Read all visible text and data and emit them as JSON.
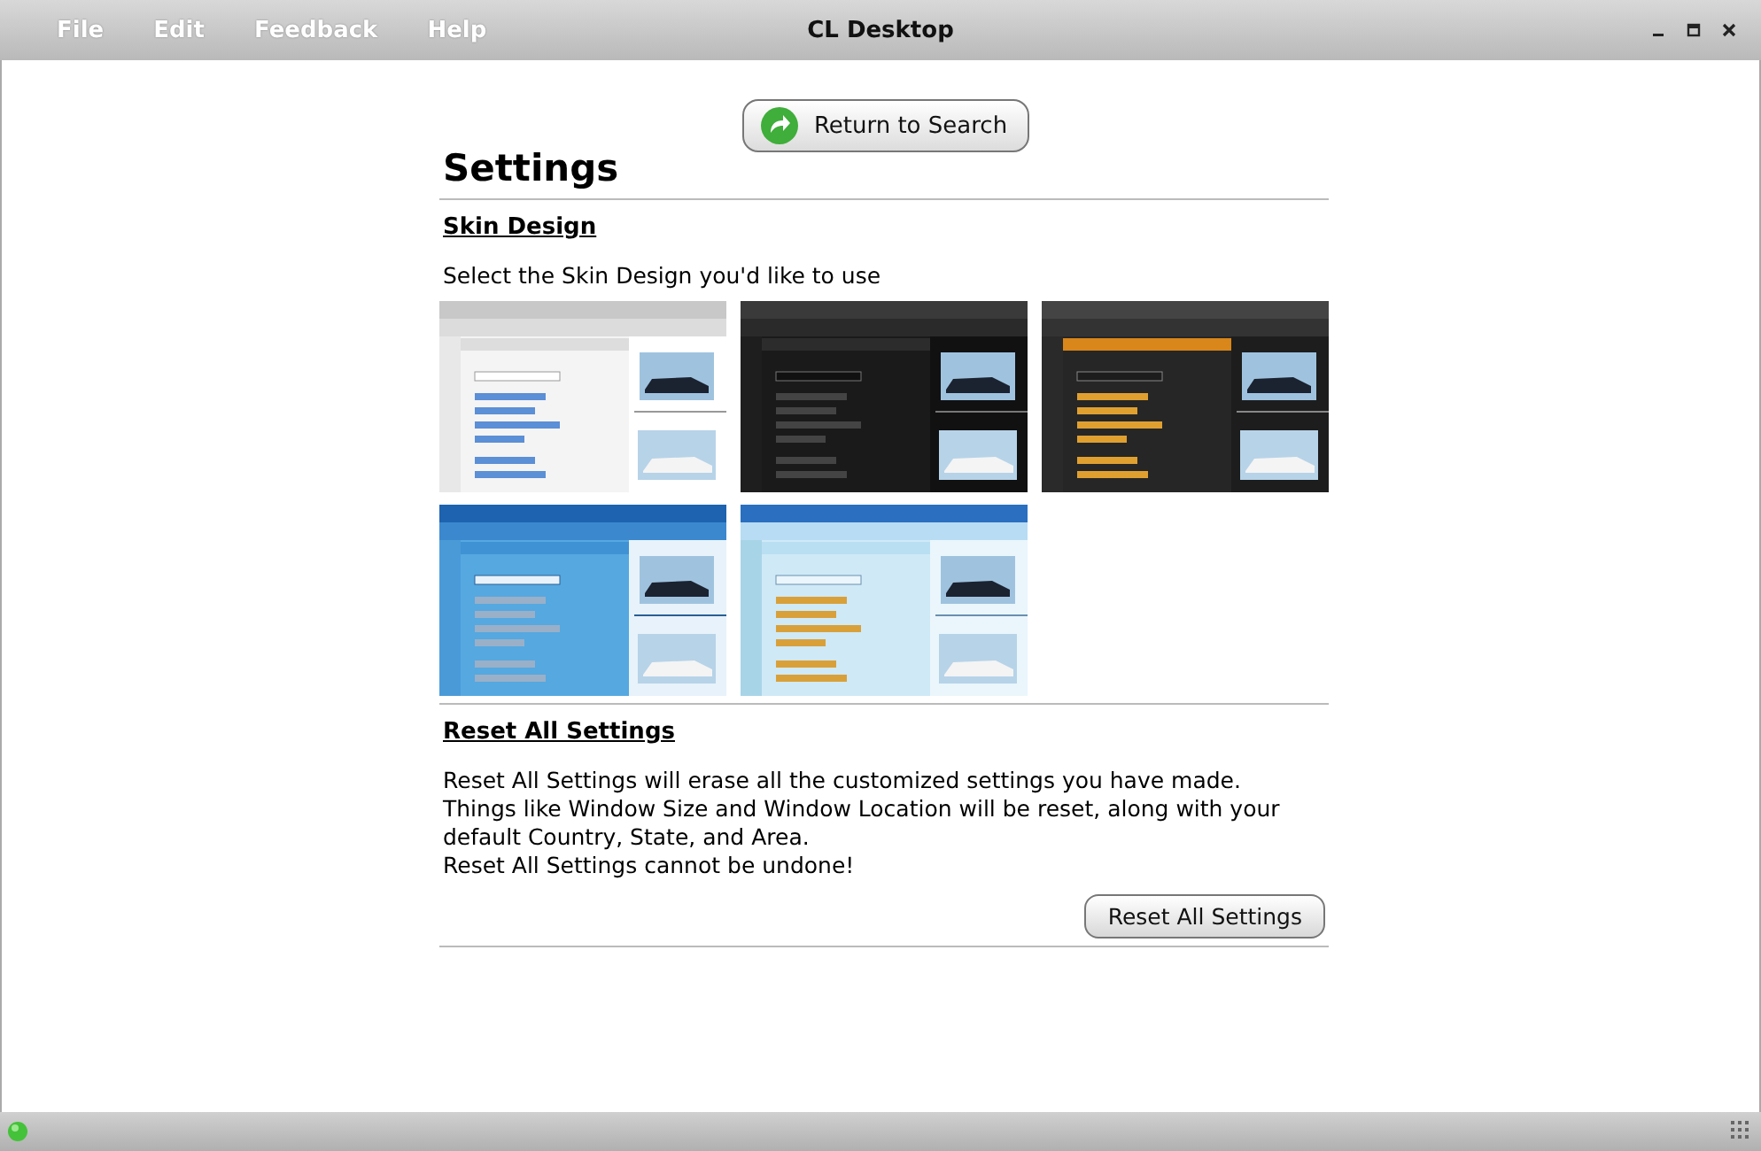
{
  "window": {
    "title": "CL Desktop"
  },
  "menu": [
    "File",
    "Edit",
    "Feedback",
    "Help"
  ],
  "return_button": "Return to Search",
  "page_title": "Settings",
  "skin_section": {
    "heading": "Skin Design",
    "prompt": "Select the Skin Design you'd like to use",
    "skins": [
      {
        "kind": "light"
      },
      {
        "kind": "dark"
      },
      {
        "kind": "orange"
      },
      {
        "kind": "blue"
      },
      {
        "kind": "aqua"
      }
    ]
  },
  "reset_section": {
    "heading": "Reset All Settings",
    "lines": [
      "Reset All Settings will erase all the customized settings you have made.",
      "Things like Window Size and Window Location will be reset, along with your default Country, State, and Area.",
      "Reset All Settings cannot be undone!"
    ],
    "button": "Reset All Settings"
  }
}
